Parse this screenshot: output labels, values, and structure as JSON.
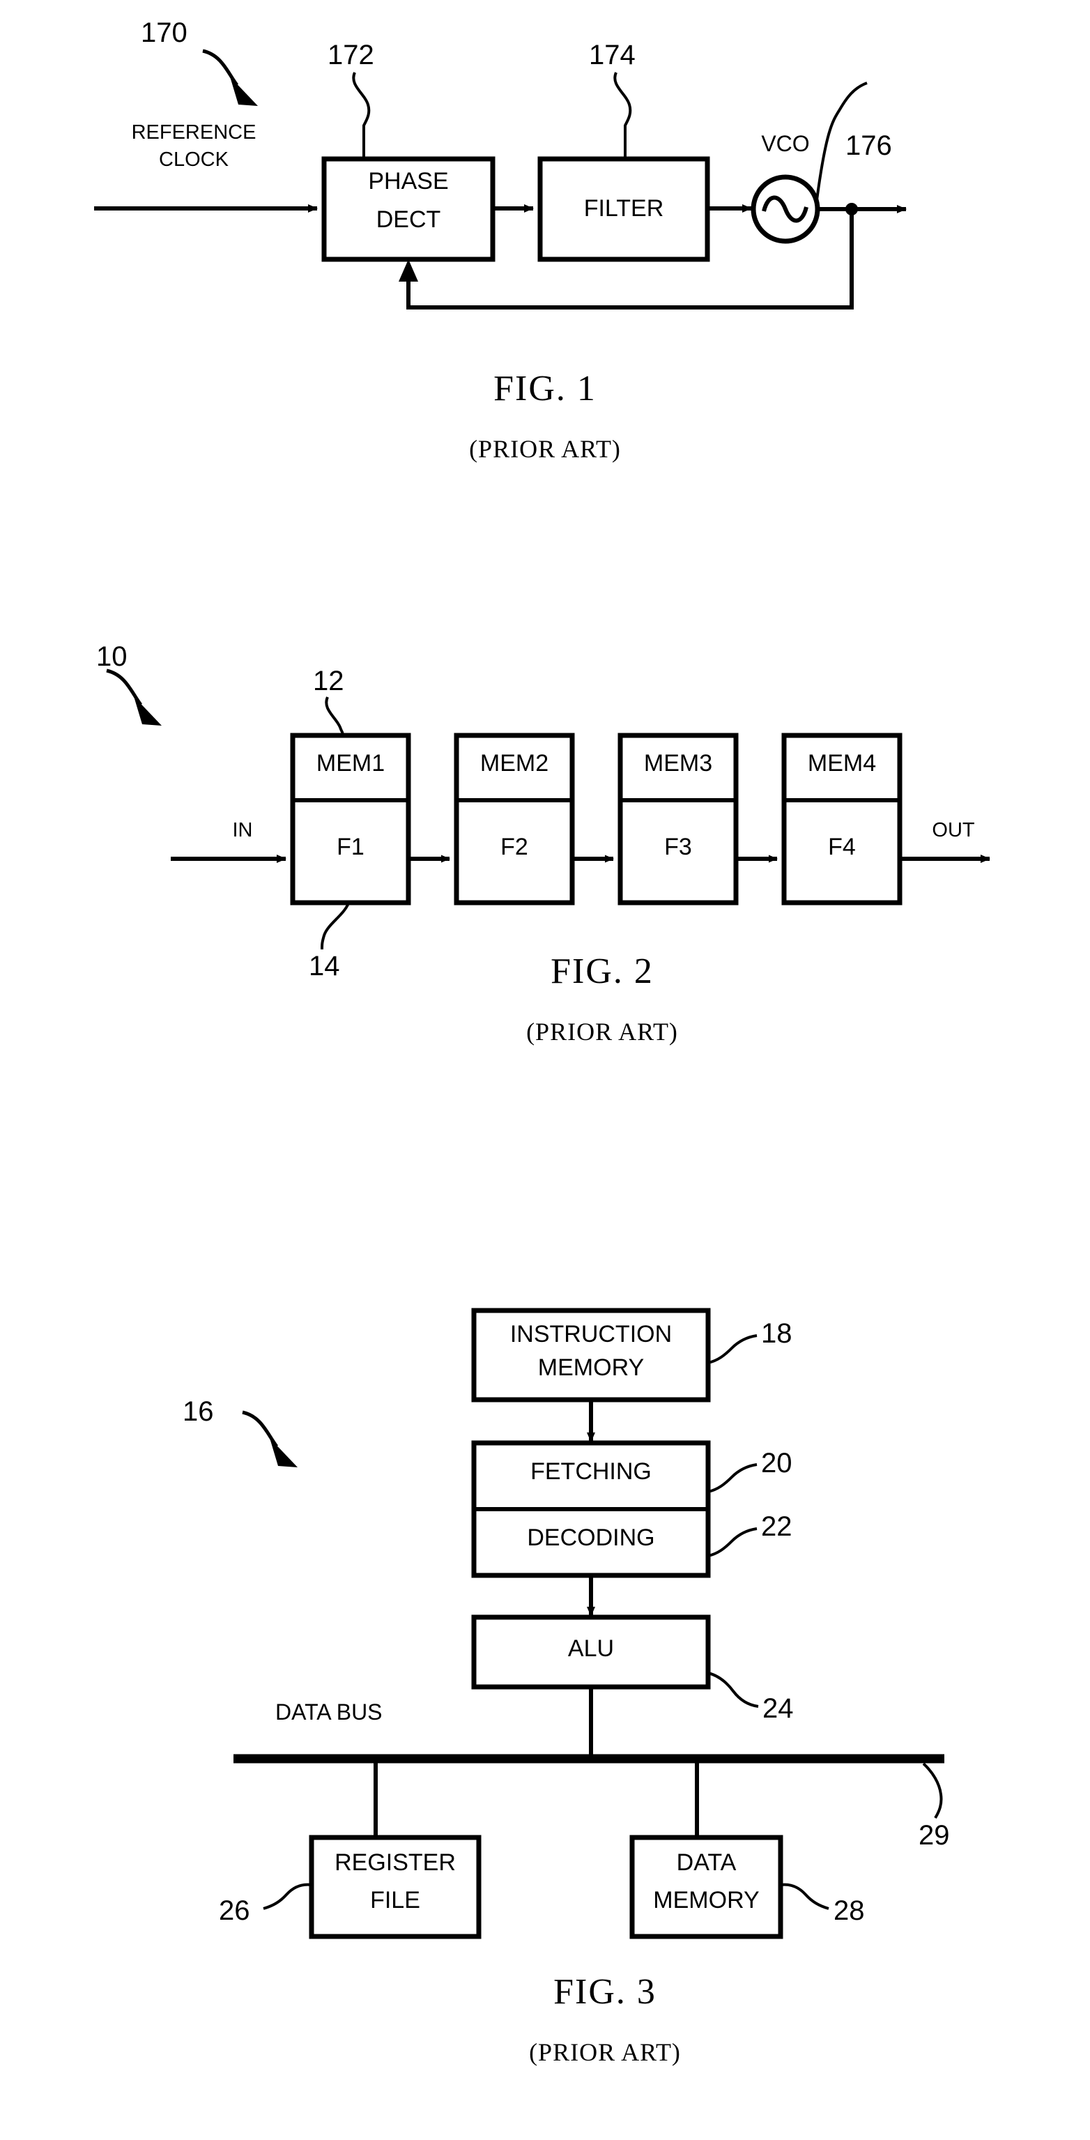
{
  "document": {
    "type": "patent-drawing-sheet",
    "background_color": "#ffffff",
    "ink_color": "#000000"
  },
  "figures": [
    {
      "id": "fig1",
      "title": "FIG. 1",
      "subtitle": "(PRIOR ART)",
      "assembly_ref": "170",
      "blocks": [
        {
          "ref": "172",
          "label_line1": "PHASE",
          "label_line2": "DECT"
        },
        {
          "ref": "174",
          "label_line1": "FILTER",
          "label_line2": ""
        },
        {
          "ref": "176",
          "label_line1": "VCO",
          "label_line2": ""
        }
      ],
      "signals": [
        {
          "name": "input",
          "label_line1": "REFERENCE",
          "label_line2": "CLOCK"
        }
      ]
    },
    {
      "id": "fig2",
      "title": "FIG. 2",
      "subtitle": "(PRIOR ART)",
      "assembly_ref": "10",
      "stage_mem_ref": "12",
      "stage_func_ref": "14",
      "stages": [
        {
          "mem": "MEM1",
          "func": "F1"
        },
        {
          "mem": "MEM2",
          "func": "F2"
        },
        {
          "mem": "MEM3",
          "func": "F3"
        },
        {
          "mem": "MEM4",
          "func": "F4"
        }
      ],
      "signals": [
        {
          "name": "input",
          "label": "IN"
        },
        {
          "name": "output",
          "label": "OUT"
        }
      ]
    },
    {
      "id": "fig3",
      "title": "FIG. 3",
      "subtitle": "(PRIOR ART)",
      "assembly_ref": "16",
      "blocks": [
        {
          "ref": "18",
          "label_line1": "INSTRUCTION",
          "label_line2": "MEMORY"
        },
        {
          "ref": "20",
          "label_line1": "FETCHING",
          "label_line2": ""
        },
        {
          "ref": "22",
          "label_line1": "DECODING",
          "label_line2": ""
        },
        {
          "ref": "24",
          "label_line1": "ALU",
          "label_line2": ""
        },
        {
          "ref": "26",
          "label_line1": "REGISTER",
          "label_line2": "FILE"
        },
        {
          "ref": "28",
          "label_line1": "DATA",
          "label_line2": "MEMORY"
        }
      ],
      "bus": {
        "ref": "29",
        "label": "DATA BUS"
      }
    }
  ]
}
